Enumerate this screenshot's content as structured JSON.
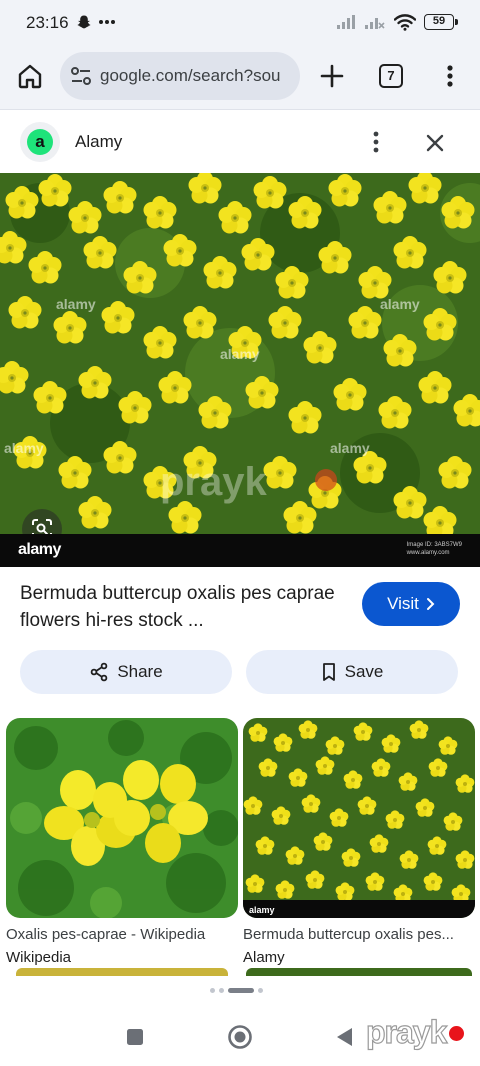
{
  "status_bar": {
    "time": "23:16",
    "left_icons": [
      "snapchat-icon",
      "more-dots-icon"
    ],
    "right_icons": [
      "signal-icon",
      "signal-off-icon",
      "wifi-icon",
      "battery-icon"
    ],
    "battery_level": "59"
  },
  "browser": {
    "url": "google.com/search?sou",
    "tab_count": "7"
  },
  "source": {
    "logo_letter": "a",
    "name": "Alamy"
  },
  "main_image": {
    "watermark_text": "alamy",
    "footer_logo": "alamy",
    "image_id": "Image ID: 3ABS7W9",
    "site": "www.alamy.com",
    "overlay_text": "prayk"
  },
  "result": {
    "title": "Bermuda buttercup oxalis pes caprae flowers hi-res stock ...",
    "visit_label": "Visit"
  },
  "actions": {
    "share_label": "Share",
    "save_label": "Save"
  },
  "related": [
    {
      "title": "Oxalis pes-caprae - Wikipedia",
      "source": "Wikipedia"
    },
    {
      "title": "Bermuda buttercup oxalis pes...",
      "source": "Alamy"
    }
  ],
  "watermark": {
    "text": "prayk"
  },
  "colors": {
    "accent": "#0b57d0",
    "chip_bg": "#e8eefa",
    "toolbar_bg": "#f1f3f8",
    "flower_yellow": "#f2e21b",
    "leaf_green": "#3f6f1c"
  }
}
